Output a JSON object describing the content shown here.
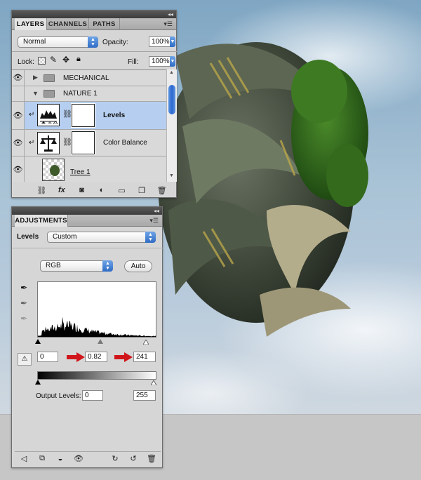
{
  "layers_panel": {
    "tabs": [
      "LAYERS",
      "CHANNELS",
      "PATHS"
    ],
    "blend_mode": "Normal",
    "opacity_label": "Opacity:",
    "opacity_value": "100%",
    "lock_label": "Lock:",
    "fill_label": "Fill:",
    "fill_value": "100%",
    "layers": [
      {
        "name": "MECHANICAL",
        "type": "group-collapsed"
      },
      {
        "name": "NATURE 1",
        "type": "group-expanded"
      },
      {
        "name": "Levels",
        "type": "adjustment",
        "selected": true
      },
      {
        "name": "Color Balance",
        "type": "adjustment"
      },
      {
        "name": "Tree 1",
        "type": "pixel"
      }
    ]
  },
  "adjustments_panel": {
    "tab": "ADJUSTMENTS",
    "title": "Levels",
    "preset": "Custom",
    "channel": "RGB",
    "auto_label": "Auto",
    "input_black": "0",
    "input_gamma": "0.82",
    "input_white": "241",
    "output_label": "Output Levels:",
    "output_black": "0",
    "output_white": "255"
  },
  "colors": {
    "selection": "#b6cff0",
    "accent_blue": "#2f6cc5",
    "arrow_red": "#d0161b"
  },
  "icons": [
    "eye-icon",
    "folder-icon",
    "triangle-icon",
    "chain-icon",
    "fx-icon",
    "mask-icon",
    "adjustment-icon",
    "new-layer-icon",
    "trash-icon",
    "eyedropper-icon",
    "clip-warning-icon",
    "back-icon",
    "expand-icon",
    "clip-icon",
    "visibility-icon",
    "previous-state-icon",
    "reset-icon"
  ]
}
